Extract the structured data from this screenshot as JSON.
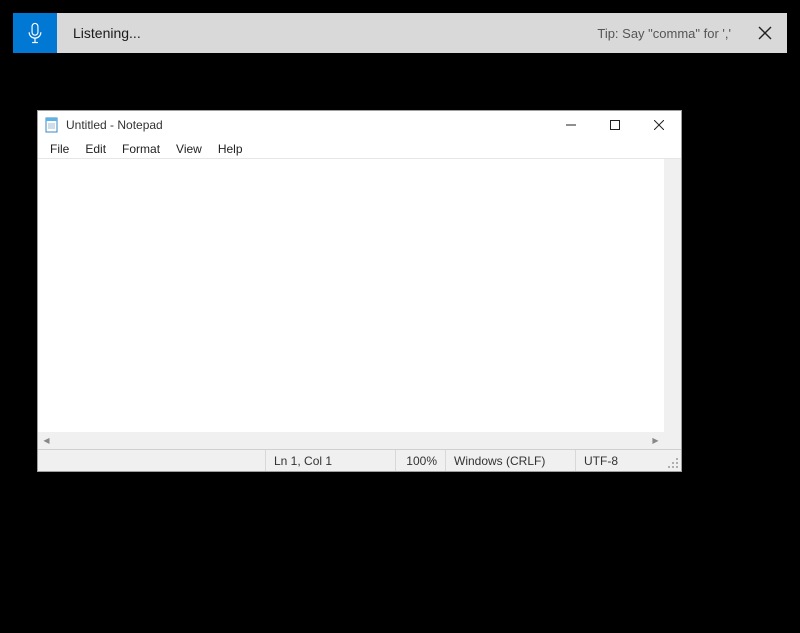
{
  "voice_bar": {
    "status": "Listening...",
    "tip": "Tip: Say \"comma\" for ','"
  },
  "notepad": {
    "title": "Untitled - Notepad",
    "menu": {
      "file": "File",
      "edit": "Edit",
      "format": "Format",
      "view": "View",
      "help": "Help"
    },
    "editor_value": "",
    "status": {
      "position": "Ln 1, Col 1",
      "zoom": "100%",
      "eol": "Windows (CRLF)",
      "encoding": "UTF-8"
    }
  }
}
